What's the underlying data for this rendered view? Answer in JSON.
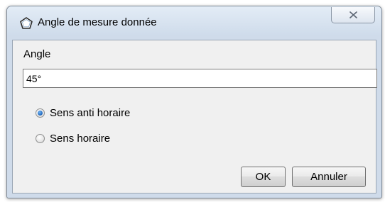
{
  "window": {
    "title": "Angle de mesure donnée",
    "icon": "pentagon-outline-icon"
  },
  "form": {
    "angle_label": "Angle",
    "angle_value": "45°",
    "radios": [
      {
        "label": "Sens anti horaire",
        "checked": true
      },
      {
        "label": "Sens horaire",
        "checked": false
      }
    ]
  },
  "buttons": {
    "ok": "OK",
    "cancel": "Annuler"
  },
  "colors": {
    "frame": "#cfdbea",
    "client": "#f0f0f0",
    "radio_accent": "#1d63b8"
  }
}
